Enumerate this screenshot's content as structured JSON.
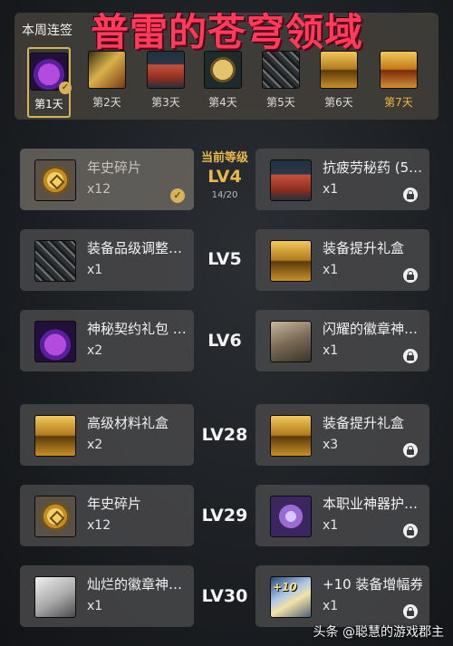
{
  "banner": {
    "title": "普雷的苍穹领域"
  },
  "signin": {
    "title": "本周连签",
    "days": [
      {
        "label": "第1天",
        "icon": "mystery-bag-icon",
        "status": "claimed"
      },
      {
        "label": "第2天",
        "icon": "scroll-icon",
        "status": "pending"
      },
      {
        "label": "第3天",
        "icon": "potion-icon",
        "status": "pending"
      },
      {
        "label": "第4天",
        "icon": "gold-coin-icon",
        "status": "pending"
      },
      {
        "label": "第5天",
        "icon": "stone-cube-icon",
        "status": "pending"
      },
      {
        "label": "第6天",
        "icon": "gold-chest-icon",
        "status": "pending"
      },
      {
        "label": "第7天",
        "icon": "treasure-chest-icon",
        "status": "pending"
      }
    ]
  },
  "current_level": {
    "caption": "当前等级",
    "level": "LV4",
    "progress": "14/20"
  },
  "rows": [
    {
      "level": "LV4",
      "left": {
        "name": "年史碎片",
        "qty": "x12",
        "icon": "chronicle-shard-icon",
        "claimed": true
      },
      "right": {
        "name": "抗疲劳秘药 (5…",
        "qty": "x1",
        "icon": "fatigue-potion-icon",
        "locked": true
      }
    },
    {
      "level": "LV5",
      "left": {
        "name": "装备品级调整…",
        "qty": "x1",
        "icon": "grade-adjust-icon"
      },
      "right": {
        "name": "装备提升礼盒",
        "qty": "x1",
        "icon": "upgrade-box-icon",
        "locked": true
      }
    },
    {
      "level": "LV6",
      "left": {
        "name": "神秘契约礼包 …",
        "qty": "x2",
        "icon": "contract-pack-icon"
      },
      "right": {
        "name": "闪耀的徽章神…",
        "qty": "x1",
        "icon": "shining-emblem-box-icon",
        "locked": true
      }
    },
    {
      "level": "LV28",
      "left": {
        "name": "高级材料礼盒",
        "qty": "x2",
        "icon": "material-box-icon"
      },
      "right": {
        "name": "装备提升礼盒",
        "qty": "x3",
        "icon": "upgrade-box-icon",
        "locked": true
      }
    },
    {
      "level": "LV29",
      "left": {
        "name": "年史碎片",
        "qty": "x12",
        "icon": "chronicle-shard-icon"
      },
      "right": {
        "name": "本职业神器护…",
        "qty": "x1",
        "icon": "artifact-armor-icon",
        "locked": true
      }
    },
    {
      "level": "LV30",
      "left": {
        "name": "灿烂的徽章神…",
        "qty": "x1",
        "icon": "brilliant-emblem-box-icon"
      },
      "right": {
        "name": "+10 装备增幅券",
        "qty": "x1",
        "icon": "amplify-ticket-icon",
        "icon_text": "+10",
        "locked": true
      }
    }
  ],
  "watermark": "头条 @聪慧的游戏郡主",
  "colors": {
    "banner_title": "#ff3b5c",
    "current_level": "#e9b949",
    "selected_border": "#d8b25a"
  }
}
